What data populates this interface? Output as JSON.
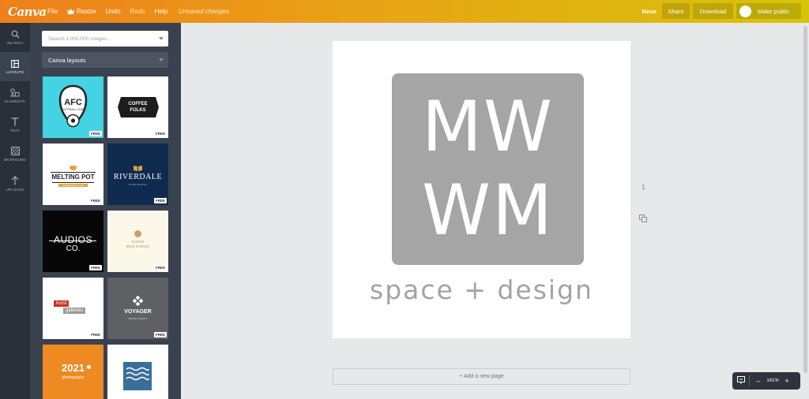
{
  "app": {
    "logo": "Canva"
  },
  "menu": {
    "file": "File",
    "resize": "Resize",
    "undo": "Undo",
    "redo": "Redo",
    "help": "Help",
    "unsaved": "Unsaved changes"
  },
  "actions": {
    "neue": "Neue",
    "share": "Share",
    "download": "Download",
    "make_public": "Make public"
  },
  "rail": [
    {
      "label": "SEARCH",
      "icon": "search-icon"
    },
    {
      "label": "LAYOUTS",
      "icon": "layouts-icon"
    },
    {
      "label": "ELEMENTS",
      "icon": "elements-icon"
    },
    {
      "label": "TEXT",
      "icon": "text-icon"
    },
    {
      "label": "BKGROUND",
      "icon": "background-icon"
    },
    {
      "label": "UPLOADS",
      "icon": "upload-icon"
    }
  ],
  "panel": {
    "search_placeholder": "Search 1,000,000 images...",
    "layout_select": "Canva layouts",
    "free_badge": "FREE",
    "tiles": {
      "afc": {
        "title": "AFC",
        "subtitle": "FOOTBALL CLUB"
      },
      "coffee": {
        "line1": "COFFEE",
        "line2": "FOLKS"
      },
      "melting": {
        "title": "MELTING POT",
        "subtitle": "HOMEMADE FOOD"
      },
      "riverdale": {
        "title": "RIVERDALE",
        "subtitle": "PUBLISHING"
      },
      "audios": {
        "line1": "AUDIOS",
        "line2": "CO."
      },
      "school": {
        "line1": "EASTON",
        "line2": "HIGH SCHOOL"
      },
      "hurst": {
        "line1": "hurst",
        "line2": "galleries"
      },
      "voyager": {
        "title": "VOYAGER",
        "subtitle": "TRAVEL AGENCY"
      },
      "year": {
        "title": "2021",
        "subtitle": "photography"
      }
    }
  },
  "canvas": {
    "logo_line1": "MW",
    "logo_line2": "WM",
    "tagline": "space + design",
    "page_number": "1",
    "add_page": "+ Add a new page"
  },
  "zoom": {
    "level": "141%",
    "minus": "–",
    "plus": "+"
  },
  "colors": {
    "topbar_start": "#ef7f1a",
    "topbar_end": "#d8c30a",
    "rail_bg": "#293039",
    "panel_bg": "#3a424f",
    "logo_gray": "#a5a5a5"
  }
}
